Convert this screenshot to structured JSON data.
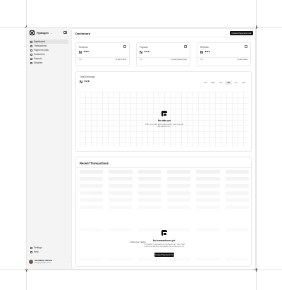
{
  "brand": {
    "name": "Hydrogen"
  },
  "sidebar": {
    "items": [
      {
        "label": "Dashboard",
        "icon": "grid-icon",
        "active": true
      },
      {
        "label": "Transactions",
        "icon": "transactions-icon"
      },
      {
        "label": "Payment Links",
        "icon": "link-icon"
      },
      {
        "label": "Customers",
        "icon": "users-icon"
      },
      {
        "label": "Payouts",
        "icon": "payout-icon"
      },
      {
        "label": "Disputes",
        "icon": "dispute-icon"
      }
    ],
    "footer": [
      {
        "label": "Settings",
        "icon": "gear-icon"
      },
      {
        "label": "Help",
        "icon": "help-icon"
      }
    ],
    "user": {
      "name": "Abubakar Haruna",
      "email": "abu@hydrogen.com"
    }
  },
  "header": {
    "title": "Dashboard",
    "cta": "Create Payment Link"
  },
  "stats": [
    {
      "label": "Revenue",
      "value": "N ***",
      "pct": "0%",
      "compare": "vs last month"
    },
    {
      "label": "Payouts",
      "value": "N ***",
      "pct": "0%",
      "compare": "vs last payout cycle"
    },
    {
      "label": "Refunds",
      "value": "N ***",
      "pct": "0%",
      "compare": "vs last week"
    }
  ],
  "earnings": {
    "label": "Total Earnings",
    "value": "N ***",
    "ranges": [
      "1H",
      "24H",
      "7D",
      "1M",
      "1Y",
      "ALL"
    ],
    "active_range": "1M",
    "empty_title": "No data yet",
    "empty_desc_1": "Once you start getting payments, your revenue",
    "empty_desc_2": "will appear here."
  },
  "recent": {
    "title": "Recent Transactions",
    "ghost_text": "Details Wate",
    "empty_title": "No transactions yet.",
    "empty_desc_1": "You haven't received any payments yet. Your most",
    "empty_desc_2": "recent transactions will appear here when you do.",
    "cta": "Create Payment Link"
  },
  "colors": {
    "accent": "#111111",
    "background": "#f4f4f4",
    "surface": "#ffffff"
  }
}
